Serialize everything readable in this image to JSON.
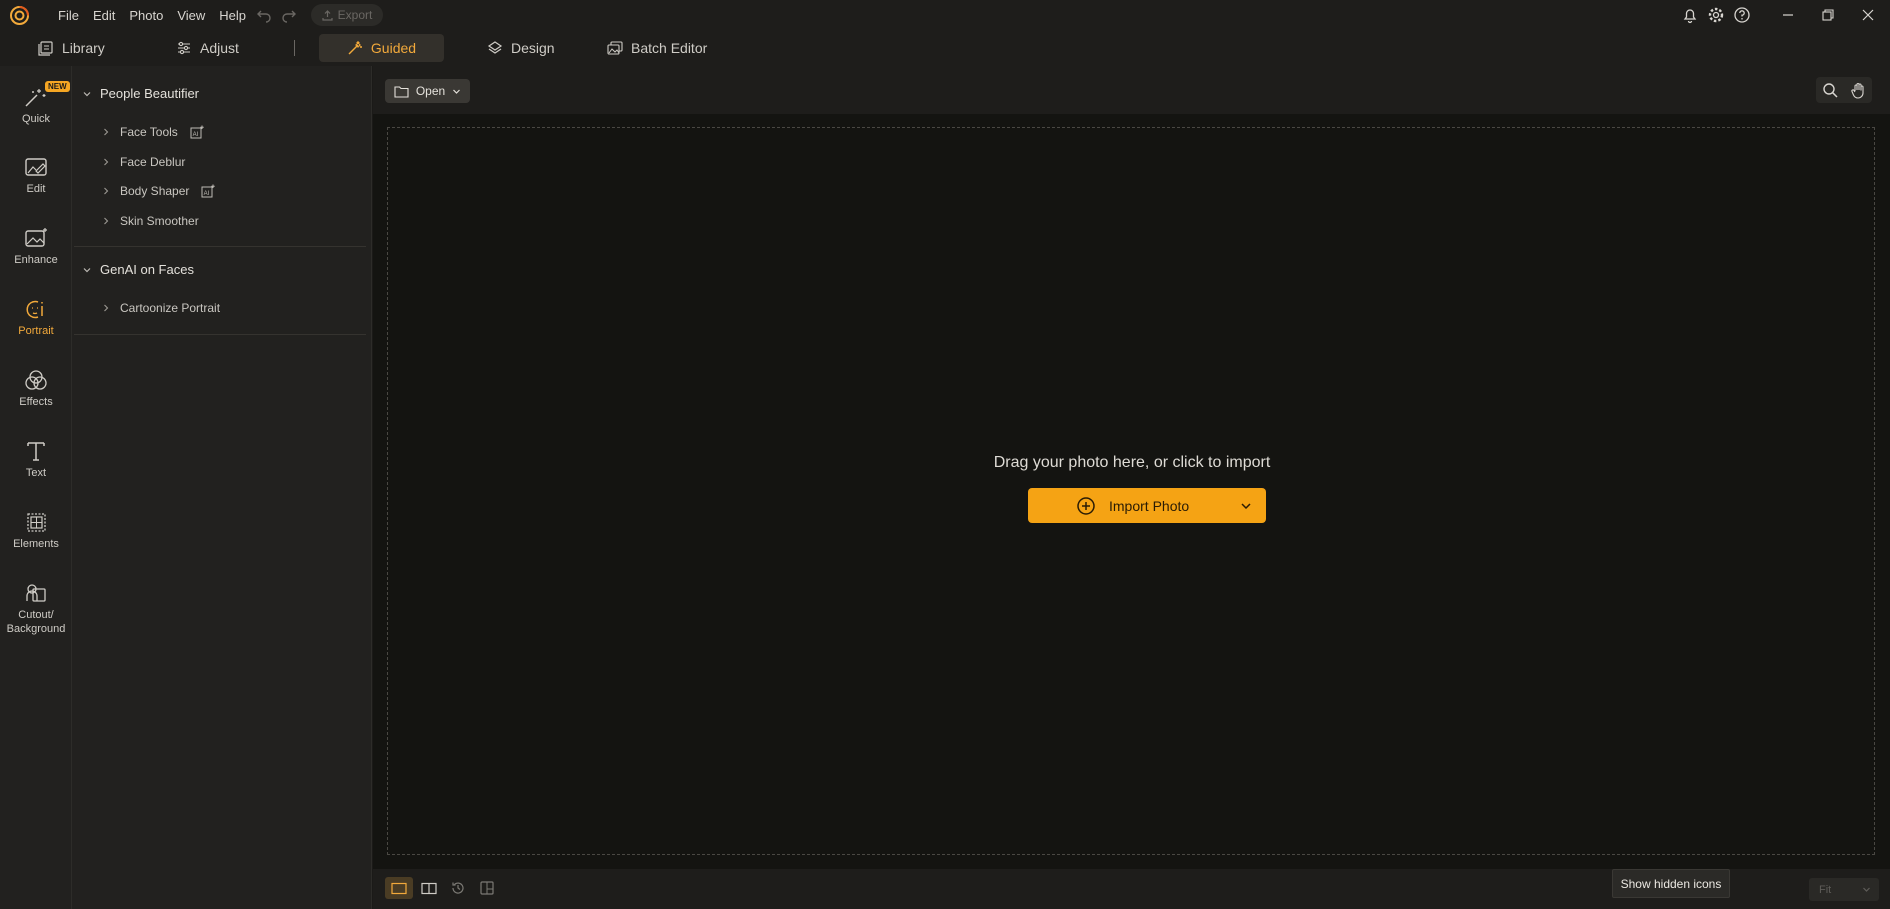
{
  "titlebar": {
    "menu": [
      "File",
      "Edit",
      "Photo",
      "View",
      "Help"
    ],
    "export_label": "Export"
  },
  "nav": {
    "tabs": [
      {
        "label": "Library",
        "icon": "library-icon"
      },
      {
        "label": "Adjust",
        "icon": "sliders-icon"
      },
      {
        "label": "Guided",
        "icon": "magic-wand-icon",
        "active": true
      },
      {
        "label": "Design",
        "icon": "layers-icon"
      },
      {
        "label": "Batch Editor",
        "icon": "batch-images-icon"
      }
    ]
  },
  "rail": {
    "new_badge": "NEW",
    "items": [
      {
        "label": "Quick",
        "icon": "quick-wand-icon"
      },
      {
        "label": "Edit",
        "icon": "edit-photo-icon"
      },
      {
        "label": "Enhance",
        "icon": "enhance-photo-icon"
      },
      {
        "label": "Portrait",
        "icon": "portrait-icon",
        "active": true
      },
      {
        "label": "Effects",
        "icon": "effects-circles-icon"
      },
      {
        "label": "Text",
        "icon": "text-icon"
      },
      {
        "label": "Elements",
        "icon": "elements-icon"
      },
      {
        "label": "Cutout/",
        "label2": "Background",
        "icon": "cutout-icon"
      }
    ]
  },
  "panel": {
    "groups": [
      {
        "title": "People Beautifier",
        "items": [
          {
            "label": "Face Tools",
            "ai": true
          },
          {
            "label": "Face Deblur",
            "ai": false
          },
          {
            "label": "Body Shaper",
            "ai": true
          },
          {
            "label": "Skin Smoother",
            "ai": false
          }
        ]
      },
      {
        "title": "GenAI on Faces",
        "items": [
          {
            "label": "Cartoonize Portrait",
            "ai": false
          }
        ]
      }
    ]
  },
  "canvas": {
    "open_label": "Open",
    "drop_text": "Drag your photo here, or click to import",
    "import_label": "Import Photo"
  },
  "bottom": {
    "tooltip": "Show hidden icons",
    "fit_label": "Fit"
  },
  "colors": {
    "accent": "#f5a314",
    "active_text": "#f2a93b",
    "background": "#141411"
  }
}
